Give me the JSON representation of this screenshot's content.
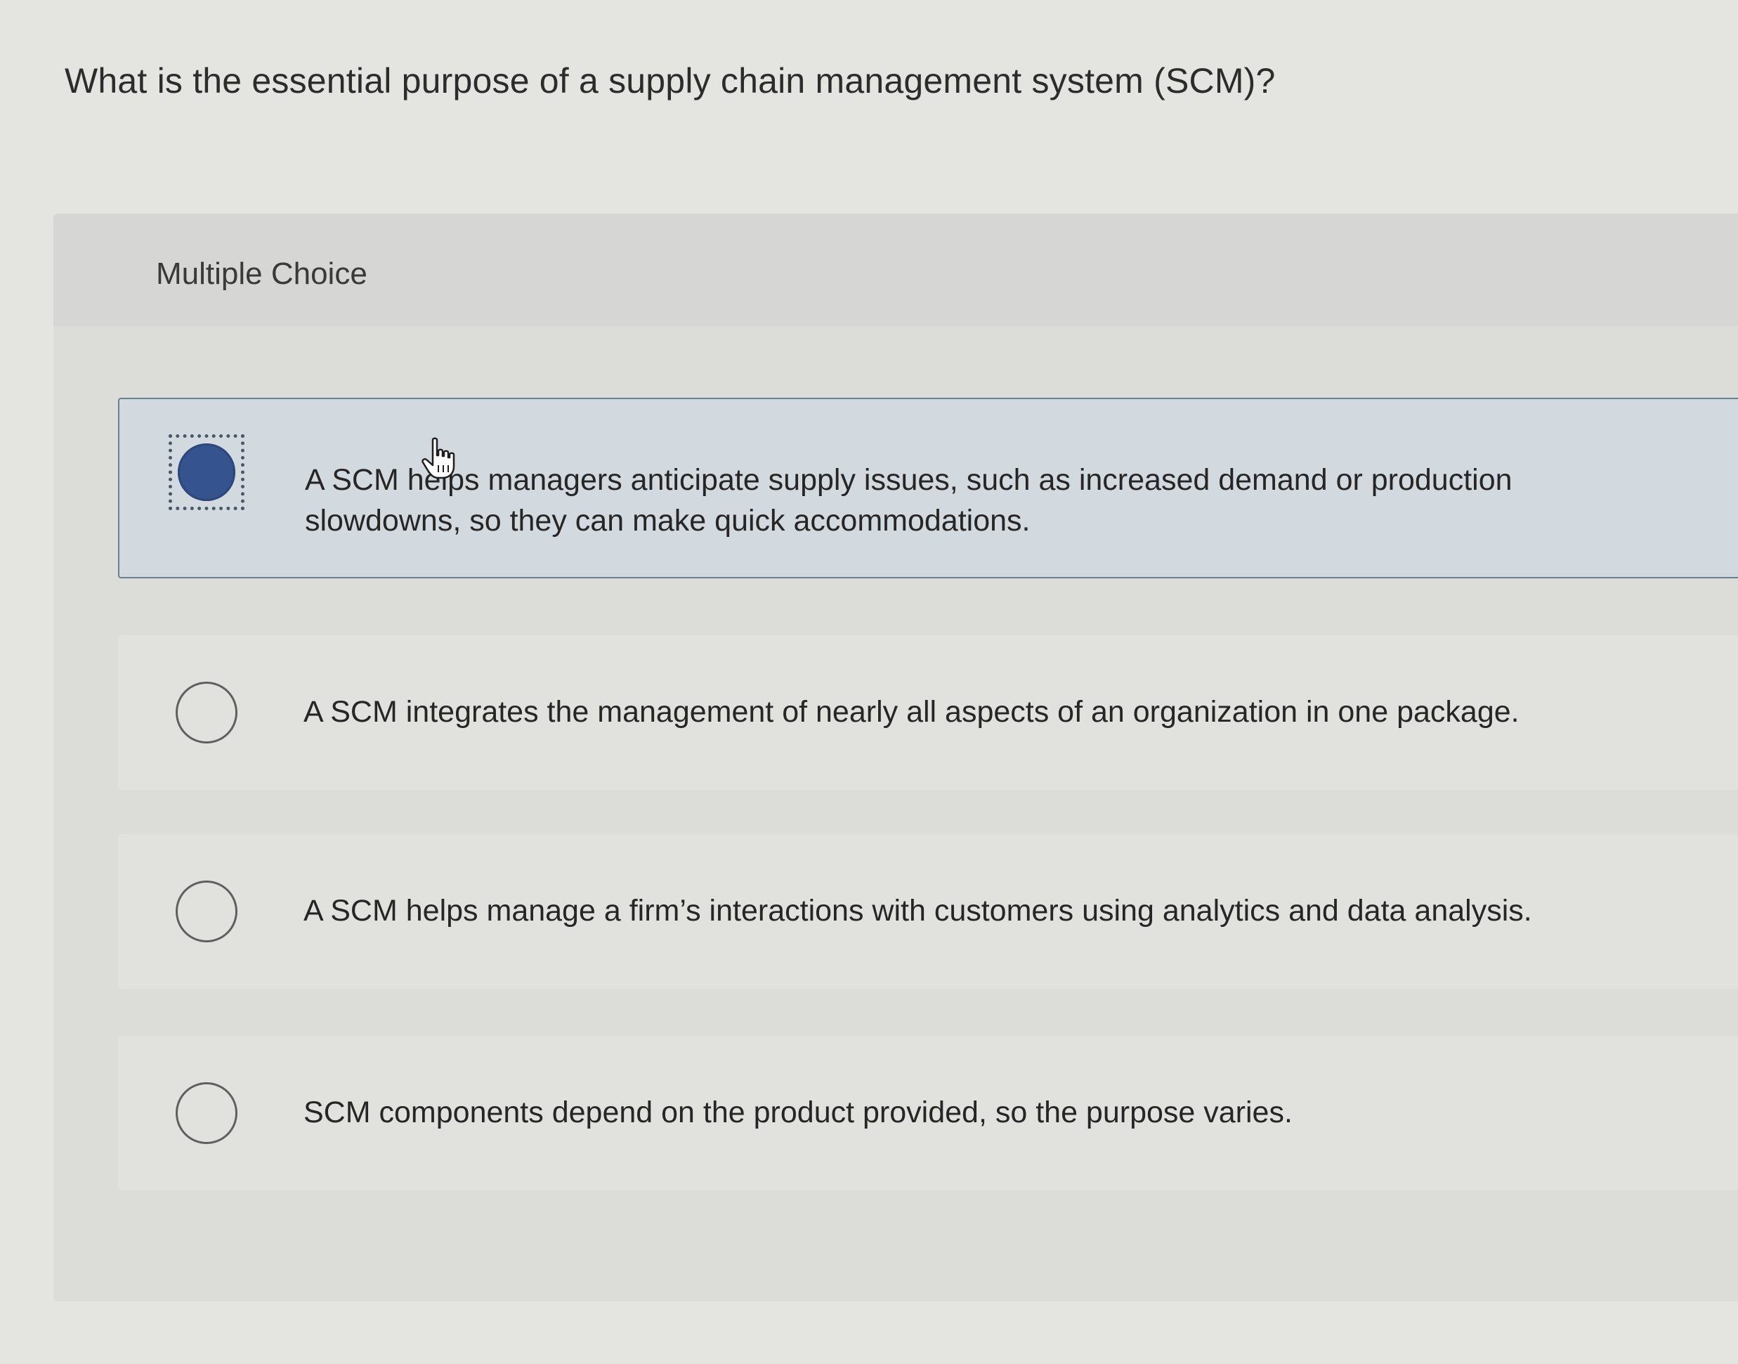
{
  "question": {
    "text": "What is the essential purpose of a supply chain management system (SCM)?"
  },
  "panel": {
    "title": "Multiple Choice"
  },
  "options": [
    {
      "text": "A SCM helps managers anticipate supply issues, such as increased demand or production slowdowns, so they can make quick accommodations.",
      "selected": true
    },
    {
      "text": "A SCM integrates the management of nearly all aspects of an organization in one package.",
      "selected": false
    },
    {
      "text": "A SCM helps manage a firm’s interactions with customers using analytics and data analysis.",
      "selected": false
    },
    {
      "text": "SCM components depend on the product provided, so the purpose varies.",
      "selected": false
    }
  ],
  "colors": {
    "selected_radio": "#34538f",
    "selected_border": "#6b7f91",
    "selected_background": "#d3dadf"
  },
  "icons": {
    "cursor": "hand-pointer-icon"
  }
}
